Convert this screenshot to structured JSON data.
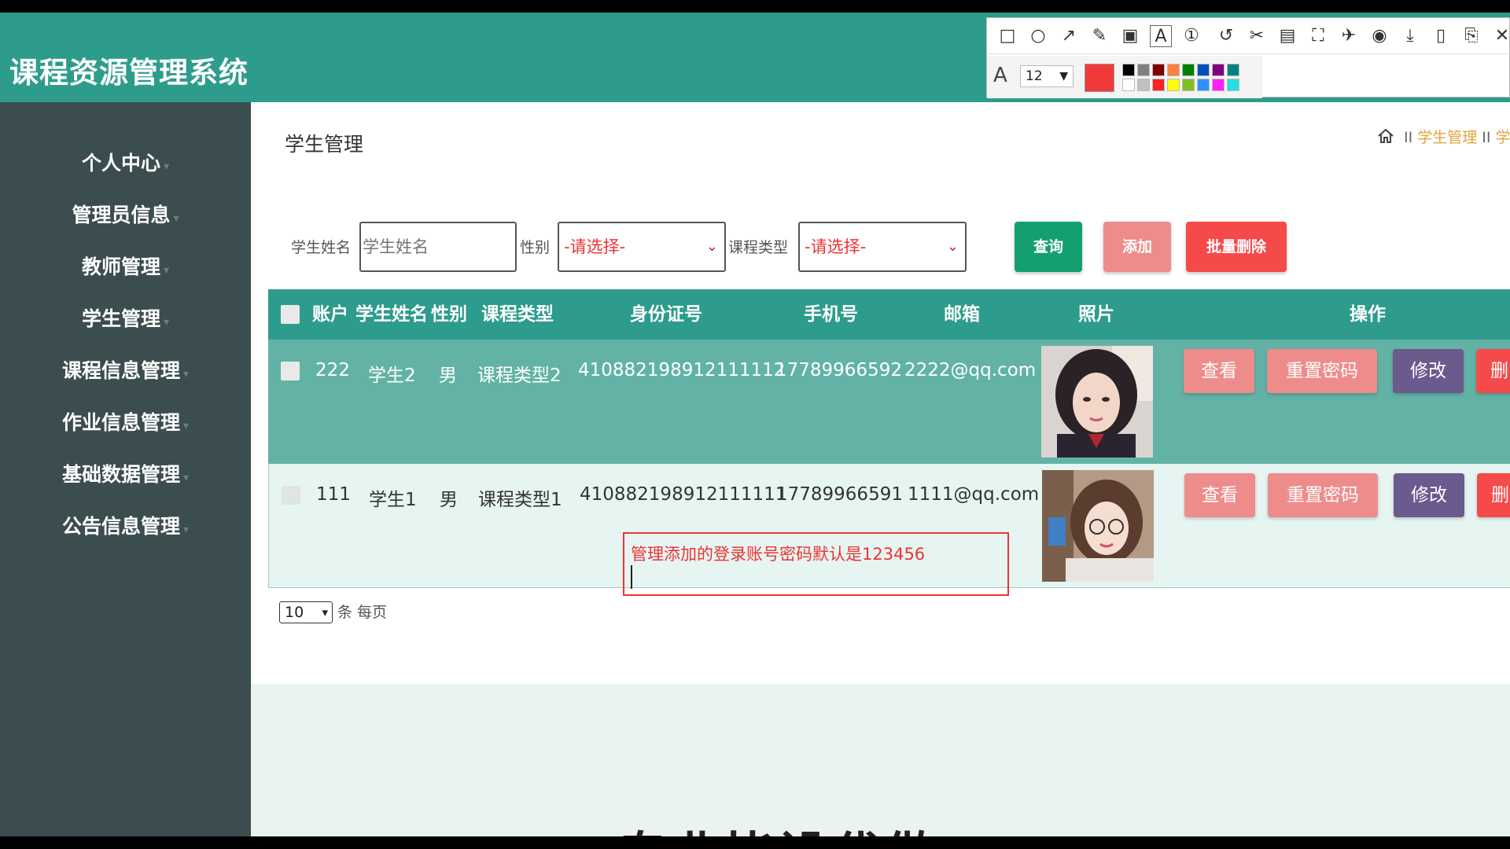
{
  "app": {
    "title": "课程资源管理系统"
  },
  "sidebar": {
    "items": [
      {
        "label": "个人中心"
      },
      {
        "label": "管理员信息"
      },
      {
        "label": "教师管理"
      },
      {
        "label": "学生管理"
      },
      {
        "label": "课程信息管理"
      },
      {
        "label": "作业信息管理"
      },
      {
        "label": "基础数据管理"
      },
      {
        "label": "公告信息管理"
      }
    ]
  },
  "page": {
    "title": "学生管理",
    "breadcrumb": {
      "sep": "II",
      "items": [
        "学生管理",
        "学"
      ]
    }
  },
  "search": {
    "name_label": "学生姓名",
    "name_placeholder": "学生姓名",
    "gender_label": "性别",
    "gender_value": "-请选择-",
    "course_type_label": "课程类型",
    "course_type_value": "-请选择-",
    "query_label": "查询",
    "add_label": "添加",
    "bulk_delete_label": "批量删除"
  },
  "table": {
    "headers": {
      "account": "账户",
      "name": "学生姓名",
      "gender": "性别",
      "course_type": "课程类型",
      "id_number": "身份证号",
      "phone": "手机号",
      "email": "邮箱",
      "photo": "照片",
      "actions": "操作"
    },
    "rows": [
      {
        "account": "222",
        "name": "学生2",
        "gender": "男",
        "course_type": "课程类型2",
        "id_number": "410882198912111112",
        "phone": "17789966592",
        "email": "2222@qq.com"
      },
      {
        "account": "111",
        "name": "学生1",
        "gender": "男",
        "course_type": "课程类型1",
        "id_number": "410882198912111111",
        "phone": "17789966591",
        "email": "1111@qq.com"
      }
    ],
    "actions": {
      "view": "查看",
      "reset": "重置密码",
      "edit": "修改",
      "delete": "删"
    }
  },
  "pager": {
    "per_page": "10",
    "per_page_suffix": "条 每页"
  },
  "annotation": {
    "text": "管理添加的登录账号密码默认是123456"
  },
  "bottom_caption": "专业毕设代做",
  "toolbar": {
    "font_size": "12",
    "current_color": "#f03a3a"
  },
  "colors": {
    "header": "#2e9c8c",
    "sidebar": "#3c4d4f",
    "accent": "#e0a43c"
  }
}
